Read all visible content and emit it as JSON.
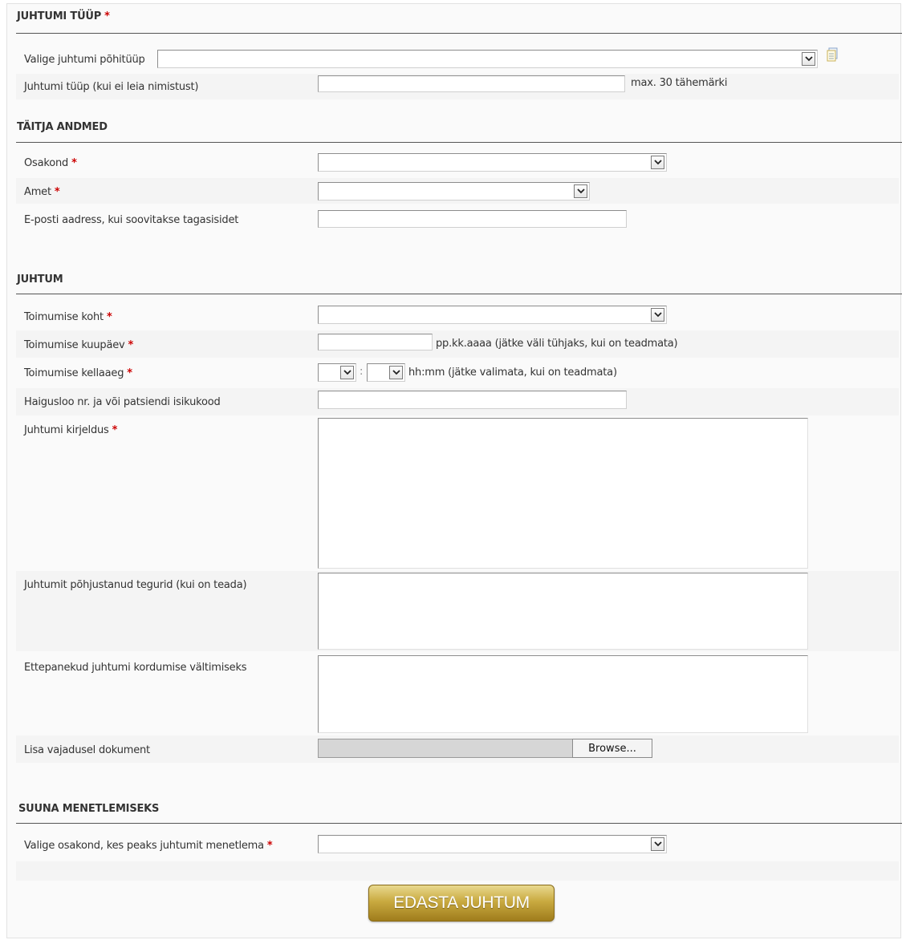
{
  "section_type": {
    "title": "JUHTUMI TÜÜP",
    "main_type_label": "Valige juhtumi põhitüüp",
    "custom_type_label": "Juhtumi tüüp (kui ei leia nimistust)",
    "custom_type_hint": "max. 30 tähemärki"
  },
  "section_author": {
    "title": "TÄITJA ANDMED",
    "department_label": "Osakond",
    "position_label": "Amet",
    "email_label": "E-posti aadress, kui soovitakse tagasisidet"
  },
  "section_case": {
    "title": "JUHTUM",
    "place_label": "Toimumise koht",
    "date_label": "Toimumise kuupäev",
    "date_hint": "pp.kk.aaaa (jätke väli tühjaks, kui on teadmata)",
    "time_label": "Toimumise kellaaeg",
    "time_separator": ":",
    "time_hint": "hh:mm (jätke valimata, kui on teadmata)",
    "patient_label": "Haigusloo nr. ja või patsiendi isikukood",
    "description_label": "Juhtumi kirjeldus",
    "causes_label": "Juhtumit põhjustanud tegurid (kui on teada)",
    "suggestions_label": "Ettepanekud juhtumi kordumise vältimiseks",
    "attachment_label": "Lisa vajadusel dokument",
    "browse_label": "Browse..."
  },
  "section_route": {
    "title": "SUUNA MENETLEMISEKS",
    "department_label": "Valige osakond, kes peaks juhtumit menetlema"
  },
  "required_marker": "*",
  "submit_label": "EDASTA JUHTUM",
  "colors": {
    "required": "#cc0000",
    "button_gold": "#c9aa40",
    "section_line": "#555555"
  }
}
